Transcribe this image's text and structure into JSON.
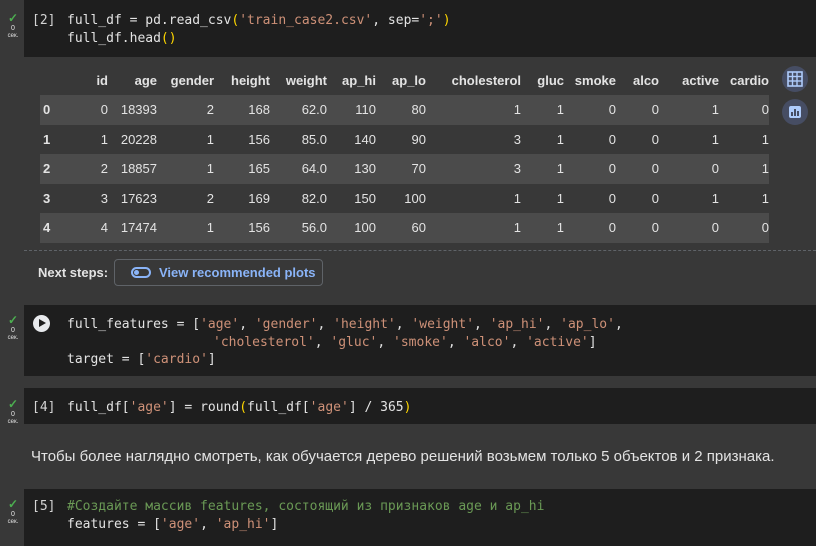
{
  "cells": [
    {
      "status": {
        "check": "✓",
        "count": "0",
        "unit": "сек."
      },
      "exec": "[2]",
      "line1": {
        "a": "full_df = pd.read_csv",
        "b": "(",
        "c": "'train_case2.csv'",
        "d": ", sep=",
        "e": "';'",
        "f": ")"
      },
      "line2": {
        "a": "full_df.head",
        "b": "()"
      }
    },
    {
      "status": {
        "check": "✓",
        "count": "0",
        "unit": "сек."
      },
      "line1": {
        "a": "full_features = [",
        "s1": "'age'",
        "s2": "'gender'",
        "s3": "'height'",
        "s4": "'weight'",
        "s5": "'ap_hi'",
        "s6": "'ap_lo'",
        "sep": ", ",
        "end": ","
      },
      "line2": {
        "s7": "'cholesterol'",
        "s8": "'gluc'",
        "s9": "'smoke'",
        "s10": "'alco'",
        "s11": "'active'",
        "sep": ", ",
        "end": "]"
      },
      "line3": {
        "a": "target = [",
        "s": "'cardio'",
        "b": "]"
      }
    },
    {
      "status": {
        "check": "✓",
        "count": "0",
        "unit": "сек."
      },
      "exec": "[4]",
      "line1": {
        "a": "full_df[",
        "s1": "'age'",
        "b": "] = round",
        "c": "(",
        "d": "full_df[",
        "s2": "'age'",
        "e": "] / 365",
        "f": ")"
      }
    },
    {
      "status": {
        "check": "✓",
        "count": "0",
        "unit": "сек."
      },
      "exec": "[5]",
      "line1": {
        "comment": "#Создайте массив features, состоящий из признаков age и ap_hi"
      },
      "line2": {
        "a": "features = [",
        "s1": "'age'",
        "sep": ", ",
        "s2": "'ap_hi'",
        "b": "]"
      }
    }
  ],
  "dataframe": {
    "columns": [
      "",
      "id",
      "age",
      "gender",
      "height",
      "weight",
      "ap_hi",
      "ap_lo",
      "cholesterol",
      "gluc",
      "smoke",
      "alco",
      "active",
      "cardio"
    ],
    "rows": [
      [
        "0",
        "0",
        "18393",
        "2",
        "168",
        "62.0",
        "110",
        "80",
        "1",
        "1",
        "0",
        "0",
        "1",
        "0"
      ],
      [
        "1",
        "1",
        "20228",
        "1",
        "156",
        "85.0",
        "140",
        "90",
        "3",
        "1",
        "0",
        "0",
        "1",
        "1"
      ],
      [
        "2",
        "2",
        "18857",
        "1",
        "165",
        "64.0",
        "130",
        "70",
        "3",
        "1",
        "0",
        "0",
        "0",
        "1"
      ],
      [
        "3",
        "3",
        "17623",
        "2",
        "169",
        "82.0",
        "150",
        "100",
        "1",
        "1",
        "0",
        "0",
        "1",
        "1"
      ],
      [
        "4",
        "4",
        "17474",
        "1",
        "156",
        "56.0",
        "100",
        "60",
        "1",
        "1",
        "0",
        "0",
        "0",
        "0"
      ]
    ]
  },
  "next_steps": {
    "label": "Next steps:",
    "button": "View recommended plots"
  },
  "markdown": "Чтобы более наглядно смотреть, как обучается дерево решений возьмем только 5 объектов и 2 признака.",
  "icons": {
    "table": "table-icon",
    "chart": "bar-chart-icon",
    "run": "play-icon",
    "toggle": "toggle-icon"
  },
  "colors": {
    "string": "#ce9178",
    "bracket": "#ffd700",
    "comment": "#6a9955",
    "link": "#8ab4f8",
    "success": "#4caf50"
  }
}
